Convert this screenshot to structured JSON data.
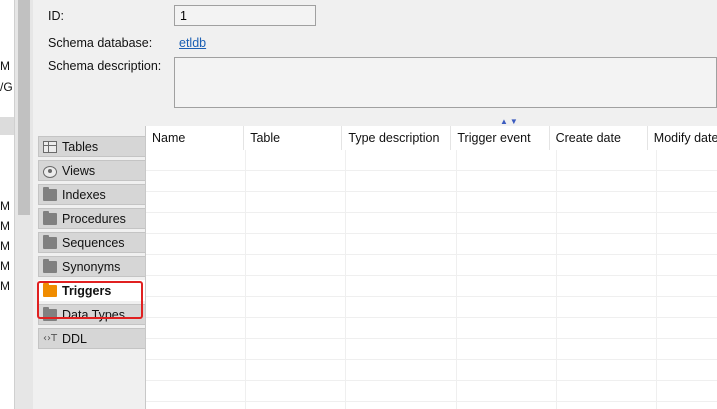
{
  "left_fragments": [
    "M",
    "/G",
    "M",
    "M",
    "M",
    "M",
    "M"
  ],
  "form": {
    "id_label": "ID:",
    "id_value": "1",
    "schema_db_label": "Schema database:",
    "schema_db_value": "etldb",
    "schema_desc_label": "Schema description:",
    "schema_desc_value": ""
  },
  "tabs": [
    {
      "label": "Tables",
      "icon": "table-icon"
    },
    {
      "label": "Views",
      "icon": "eye-icon"
    },
    {
      "label": "Indexes",
      "icon": "folder-icon"
    },
    {
      "label": "Procedures",
      "icon": "folder-icon"
    },
    {
      "label": "Sequences",
      "icon": "folder-icon"
    },
    {
      "label": "Synonyms",
      "icon": "folder-icon"
    },
    {
      "label": "Triggers",
      "icon": "folder-icon",
      "active": true
    },
    {
      "label": "Data Types",
      "icon": "folder-icon"
    },
    {
      "label": "DDL",
      "icon": "ddl-icon"
    }
  ],
  "grid": {
    "columns": [
      "Name",
      "Table",
      "Type description",
      "Trigger event",
      "Create date",
      "Modify date"
    ]
  },
  "colors": {
    "highlight": "#e02020",
    "active_folder": "#f08c00",
    "link": "#1a5fb4"
  }
}
